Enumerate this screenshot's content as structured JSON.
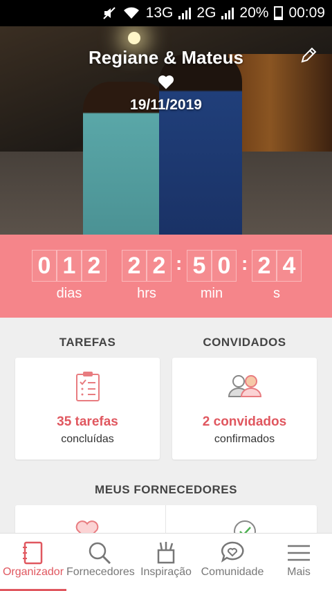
{
  "status_bar": {
    "network1": "1",
    "tech1": "3G",
    "network2": "2",
    "tech2": "G",
    "battery": "20%",
    "time": "00:09"
  },
  "hero": {
    "couple": "Regiane & Mateus",
    "date": "19/11/2019"
  },
  "countdown": {
    "days": [
      "0",
      "1",
      "2"
    ],
    "hours": [
      "2",
      "2"
    ],
    "minutes": [
      "5",
      "0"
    ],
    "seconds": [
      "2",
      "4"
    ],
    "days_label": "dias",
    "hours_label": "hrs",
    "minutes_label": "min",
    "seconds_label": "s"
  },
  "tasks": {
    "title": "TAREFAS",
    "count": "35 tarefas",
    "status": "concluídas"
  },
  "guests": {
    "title": "CONVIDADOS",
    "count": "2 convidados",
    "status": "confirmados"
  },
  "vendors": {
    "title": "MEUS FORNECEDORES"
  },
  "nav": {
    "items": [
      {
        "label": "Organizador",
        "active": true
      },
      {
        "label": "Fornecedores"
      },
      {
        "label": "Inspiração"
      },
      {
        "label": "Comunidade"
      },
      {
        "label": "Mais"
      }
    ]
  },
  "colors": {
    "accent": "#e0575f",
    "countdown_bg": "#f5858a"
  }
}
